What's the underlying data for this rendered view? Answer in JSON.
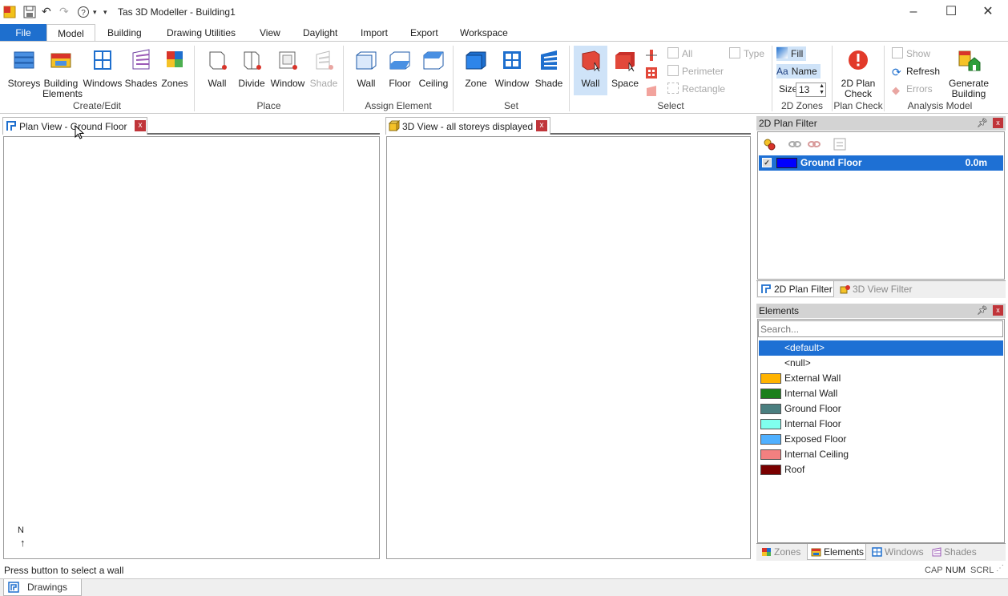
{
  "window": {
    "title": "Tas 3D Modeller - Building1"
  },
  "tabs": [
    "File",
    "Model",
    "Building",
    "Drawing Utilities",
    "View",
    "Daylight",
    "Import",
    "Export",
    "Workspace"
  ],
  "ribbon": {
    "create_edit": {
      "label": "Create/Edit",
      "storeys": "Storeys",
      "building": "Building",
      "elements": "Elements",
      "windows": "Windows",
      "shades": "Shades",
      "zones": "Zones"
    },
    "place": {
      "label": "Place",
      "wall": "Wall",
      "divide": "Divide",
      "window": "Window",
      "shade": "Shade"
    },
    "assign": {
      "label": "Assign Element",
      "wall": "Wall",
      "floor": "Floor",
      "ceiling": "Ceiling"
    },
    "set": {
      "label": "Set",
      "zone": "Zone",
      "window": "Window",
      "shade": "Shade"
    },
    "select": {
      "label": "Select",
      "wall": "Wall",
      "space": "Space",
      "all": "All",
      "perimeter": "Perimeter",
      "rectangle": "Rectangle",
      "type": "Type"
    },
    "zones2d": {
      "label": "2D Zones",
      "fill": "Fill",
      "name": "Name",
      "size_label": "Size",
      "size_value": "13"
    },
    "plan_check": {
      "label": "Plan Check",
      "btn1": "2D Plan",
      "btn2": "Check"
    },
    "analysis": {
      "label": "Analysis Model",
      "show": "Show",
      "refresh": "Refresh",
      "errors": "Errors",
      "gen1": "Generate",
      "gen2": "Building"
    }
  },
  "documents": {
    "plan_view": "Plan View - Ground Floor",
    "view3d": "3D View - all storeys displayed",
    "north": "N"
  },
  "plan_filter": {
    "title": "2D Plan Filter",
    "storey_name": "Ground Floor",
    "storey_height": "0.0m",
    "storey_color": "#0000ff",
    "tabs": [
      "2D Plan Filter",
      "3D View Filter"
    ]
  },
  "elements_panel": {
    "title": "Elements",
    "search_placeholder": "Search...",
    "items": [
      {
        "label": "<default>",
        "color": ""
      },
      {
        "label": "<null>",
        "color": ""
      },
      {
        "label": "External Wall",
        "color": "#ffb300"
      },
      {
        "label": "Internal Wall",
        "color": "#1a7f1a"
      },
      {
        "label": "Ground Floor",
        "color": "#4a7f80"
      },
      {
        "label": "Internal Floor",
        "color": "#80ffee"
      },
      {
        "label": "Exposed Floor",
        "color": "#4fb0ff"
      },
      {
        "label": "Internal Ceiling",
        "color": "#f28080"
      },
      {
        "label": "Roof",
        "color": "#7a0000"
      }
    ],
    "tabs": [
      "Zones",
      "Elements",
      "Windows",
      "Shades"
    ]
  },
  "status": {
    "message": "Press button to select a wall",
    "cap": "CAP",
    "num": "NUM",
    "scrl": "SCRL",
    "drawings_tab": "Drawings"
  }
}
